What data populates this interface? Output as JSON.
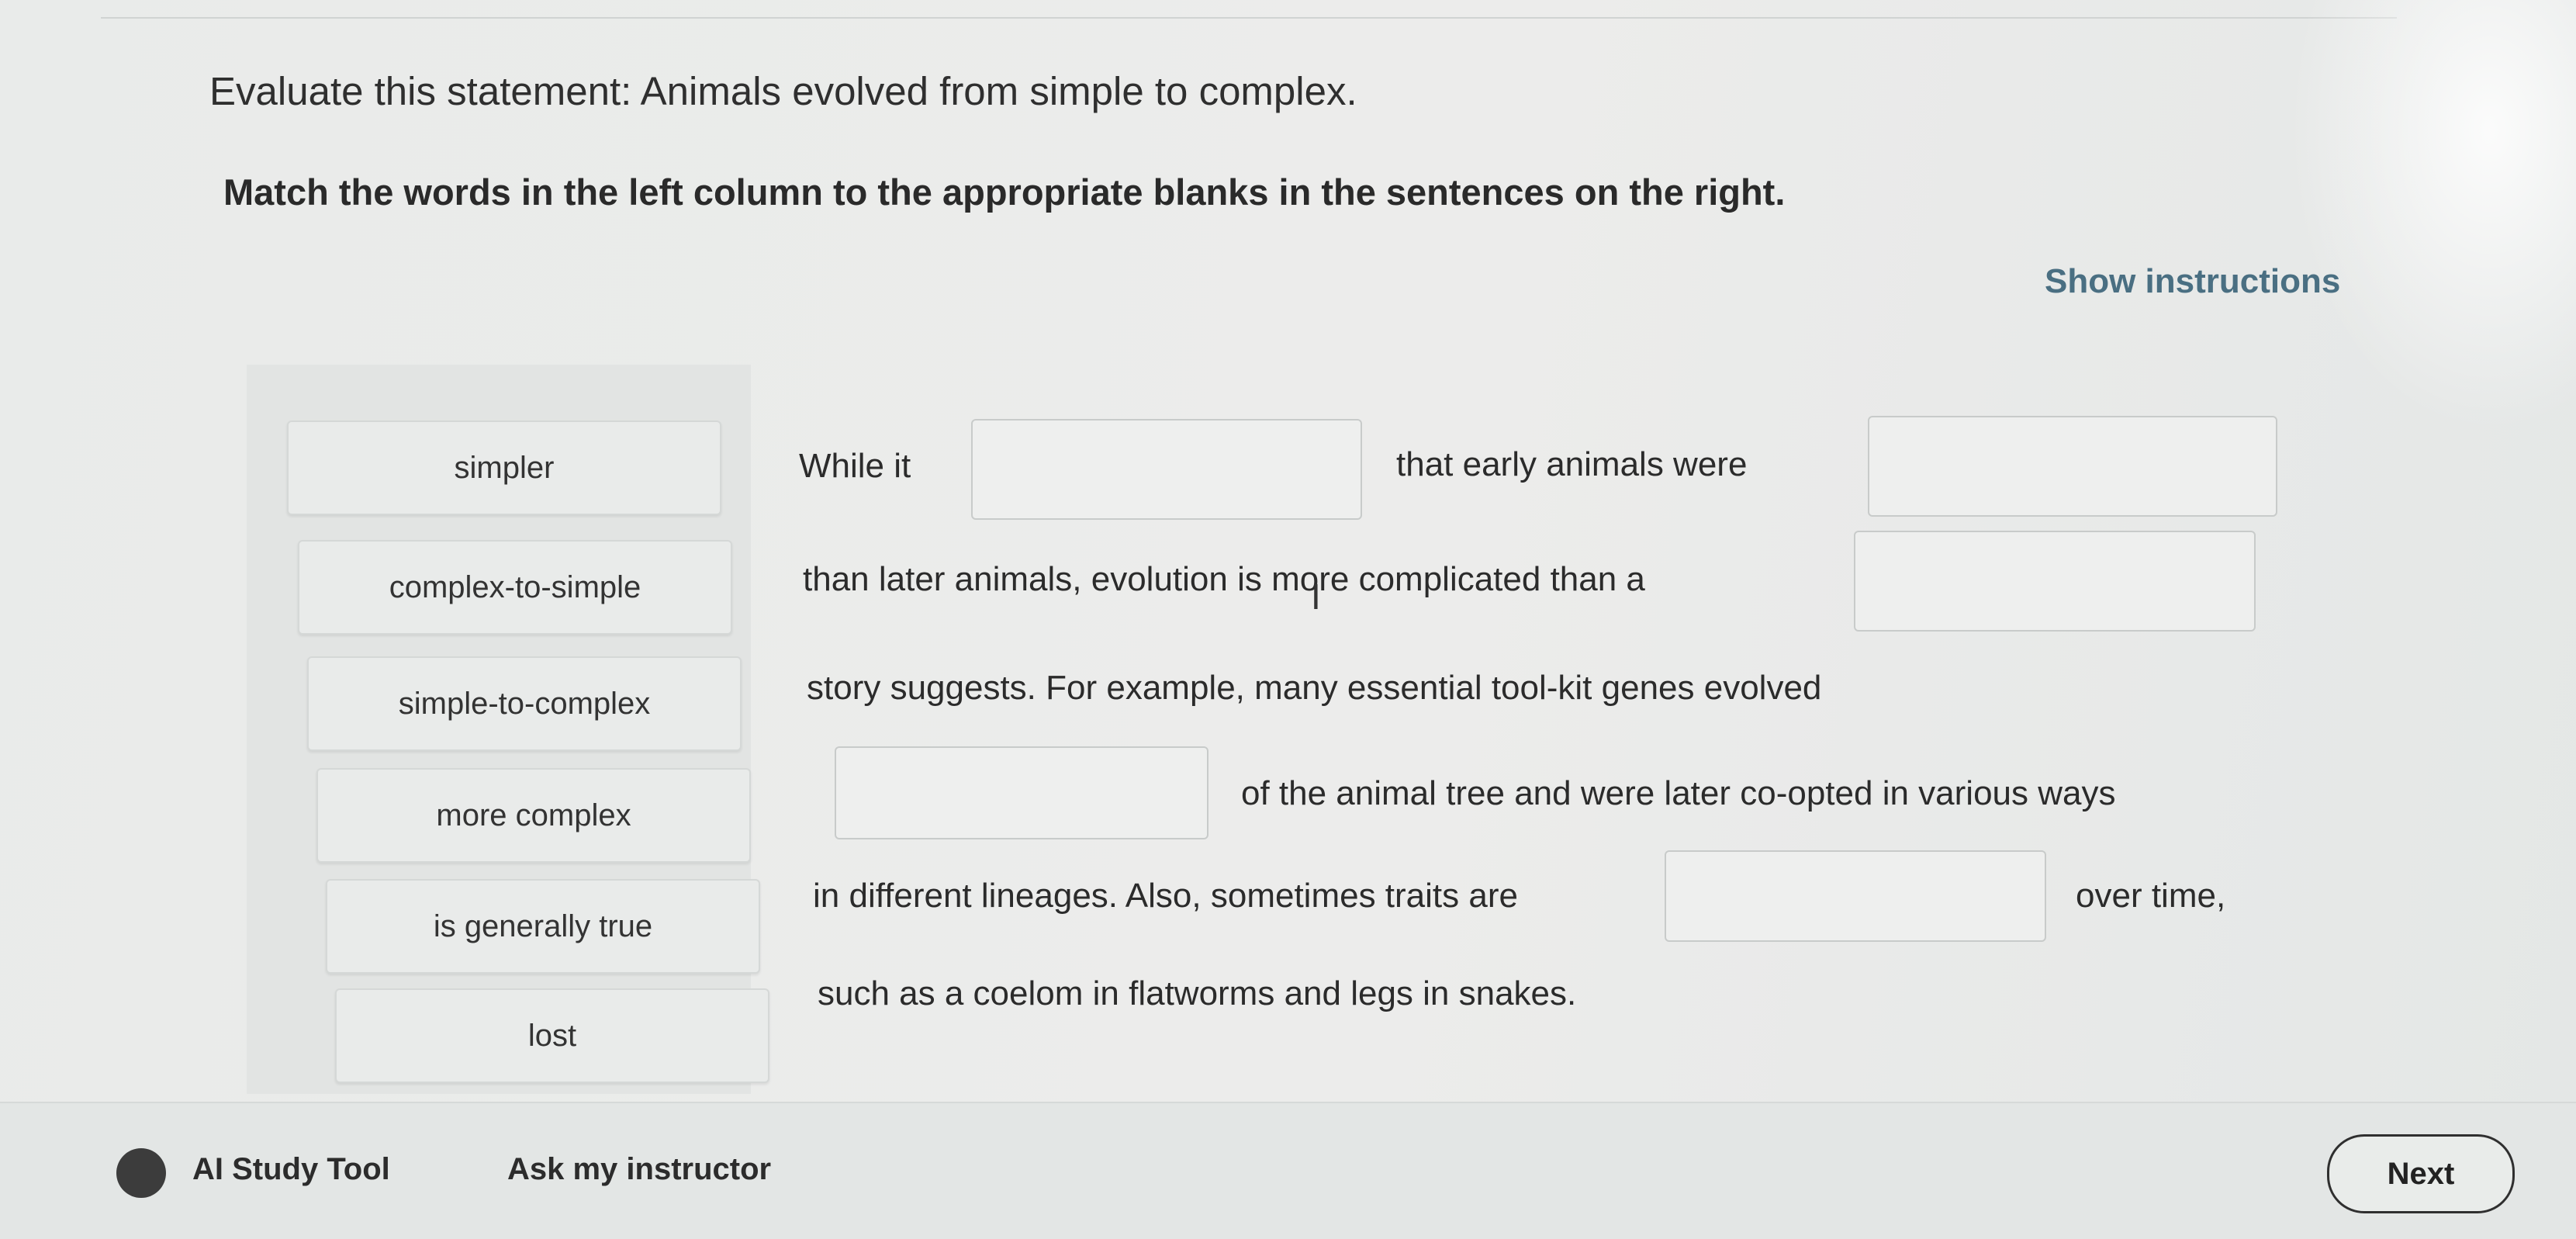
{
  "question": {
    "statement": "Evaluate this statement: Animals evolved from simple to complex.",
    "instruction": "Match the words in the left column to the appropriate blanks in the sentences on the right.",
    "show_instructions": "Show instructions"
  },
  "word_bank": [
    "simpler",
    "complex-to-simple",
    "simple-to-complex",
    "more complex",
    "is generally true",
    "lost"
  ],
  "sentence": {
    "seg1": "While it",
    "seg2": "that early animals were",
    "seg3": "than later animals, evolution is more complicated than a",
    "seg4": "story suggests. For example, many essential tool-kit genes evolved",
    "seg5": "of the animal tree and were later co-opted in various ways",
    "seg6": "in different lineages. Also, sometimes traits are",
    "seg7": "over time,",
    "seg8": "such as a coelom in flatworms and legs in snakes."
  },
  "footer": {
    "ai_study_tool": "AI Study Tool",
    "ask_instructor": "Ask my instructor",
    "next": "Next"
  },
  "colors": {
    "link": "#4a6f82",
    "background": "#eceeed"
  }
}
